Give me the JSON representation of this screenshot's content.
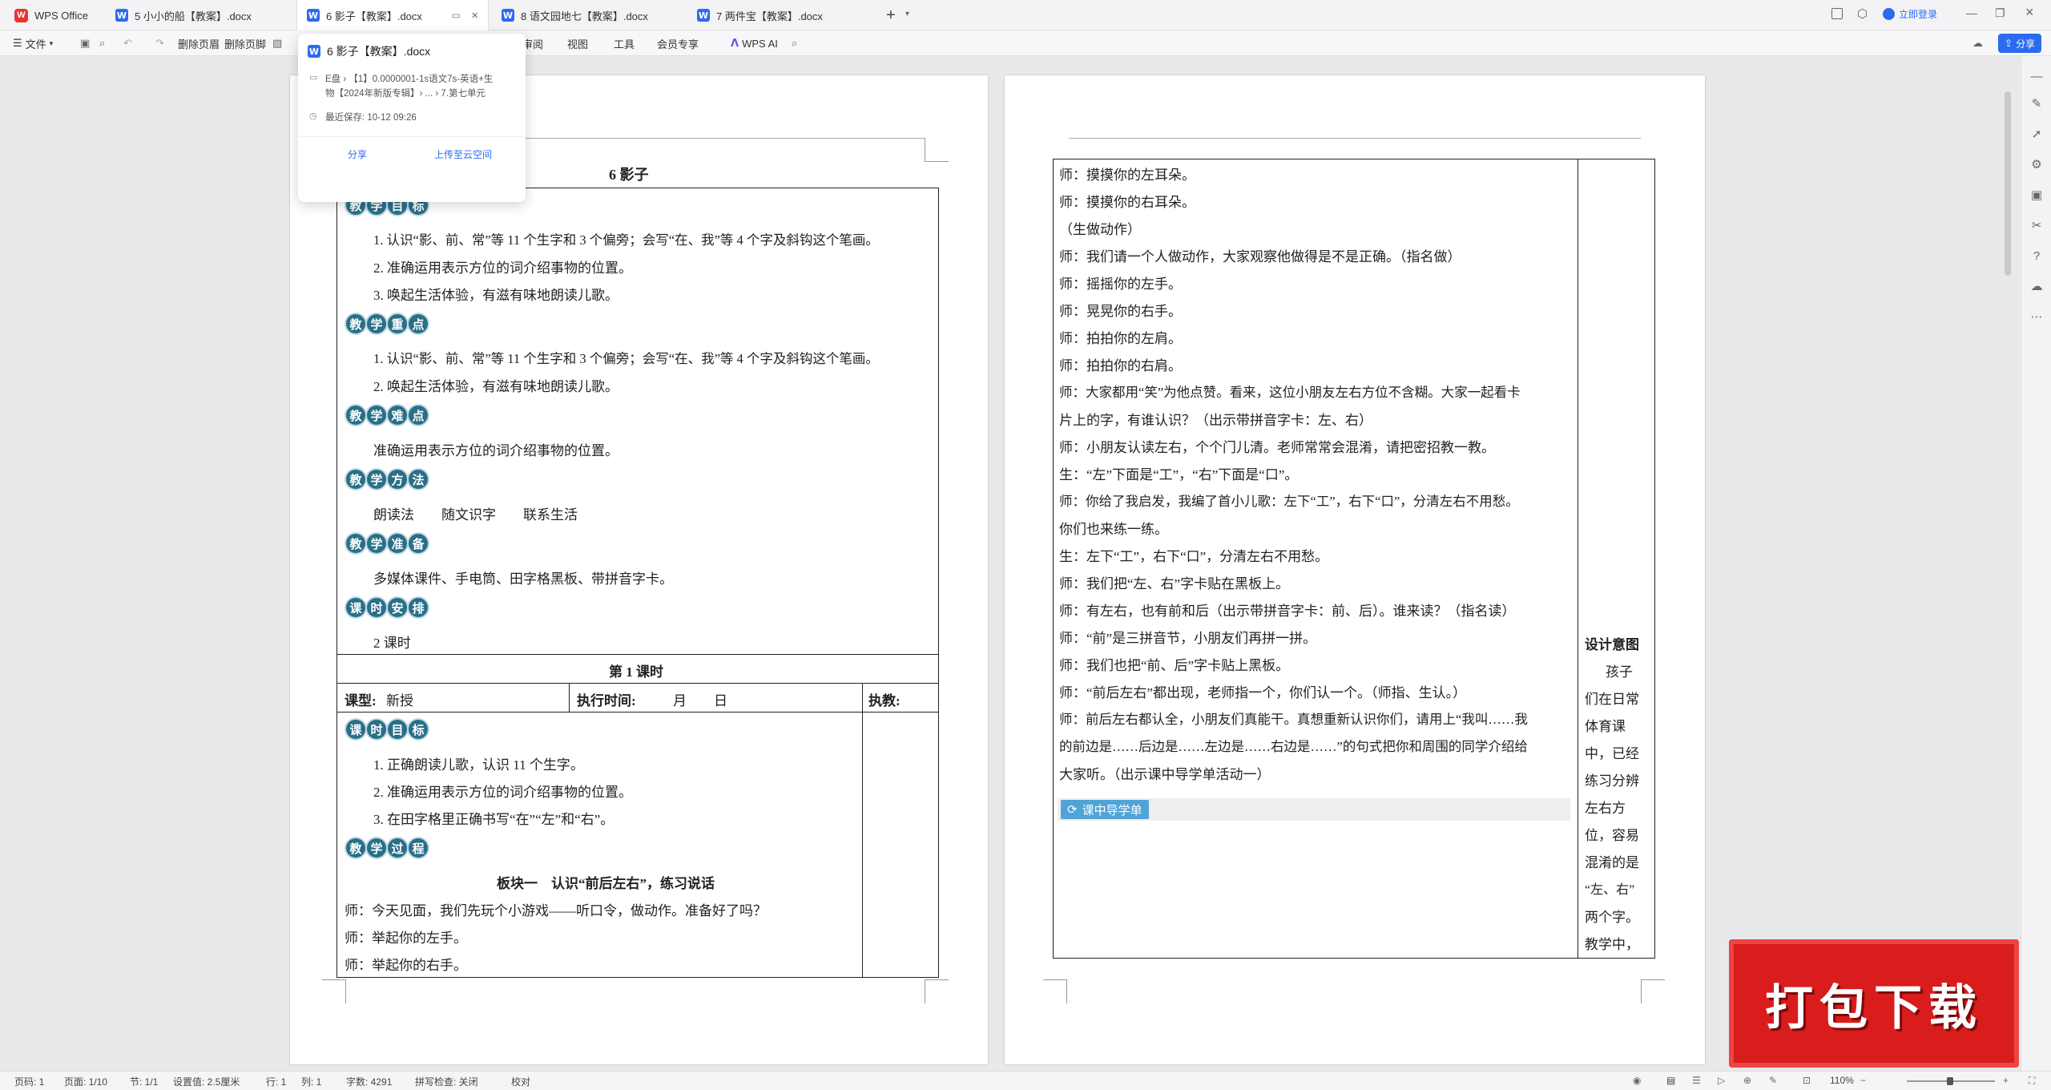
{
  "tabs": {
    "app": "WPS Office",
    "items": [
      {
        "label": "5 小小的船【教案】.docx"
      },
      {
        "label": "6 影子【教案】.docx"
      },
      {
        "label": "8 语文园地七【教案】.docx"
      },
      {
        "label": "7 两件宝【教案】.docx"
      }
    ],
    "login": "立即登录"
  },
  "menubar": {
    "file": "文件",
    "delete_header": "删除页眉",
    "delete_footer": "删除页脚",
    "review": "审阅",
    "view": "视图",
    "tools": "工具",
    "member": "会员专享",
    "wps_ai": "WPS AI",
    "share": "分享"
  },
  "popup": {
    "title": "6 影子【教案】.docx",
    "path_line1": "E盘 › 【1】0.0000001-1s语文7s-英语+生",
    "path_line2": "物【2024年新版专辑】› ... › 7.第七单元",
    "saved": "最近保存: 10-12 09:26",
    "share": "分享",
    "upload": "上传至云空间"
  },
  "left_page": {
    "title": "6 影子",
    "sections": {
      "goals": [
        "教",
        "学",
        "目",
        "标"
      ],
      "key": [
        "教",
        "学",
        "重",
        "点"
      ],
      "difficult": [
        "教",
        "学",
        "难",
        "点"
      ],
      "method": [
        "教",
        "学",
        "方",
        "法"
      ],
      "prep": [
        "教",
        "学",
        "准",
        "备"
      ],
      "schedule": [
        "课",
        "时",
        "安",
        "排"
      ],
      "lesson_goals": [
        "课",
        "时",
        "目",
        "标"
      ],
      "process": [
        "教",
        "学",
        "过",
        "程"
      ]
    },
    "goals_lines": [
      "1. 认识“影、前、常”等 11 个生字和 3 个偏旁；会写“在、我”等 4 个字及斜钩这个笔画。",
      "2. 准确运用表示方位的词介绍事物的位置。",
      "3. 唤起生活体验，有滋有味地朗读儿歌。"
    ],
    "key_lines": [
      "1. 认识“影、前、常”等 11 个生字和 3 个偏旁；会写“在、我”等 4 个字及斜钩这个笔画。",
      "2. 唤起生活体验，有滋有味地朗读儿歌。"
    ],
    "difficult_line": "准确运用表示方位的词介绍事物的位置。",
    "method_line": "朗读法　　随文识字　　联系生活",
    "prep_line": "多媒体课件、手电筒、田字格黑板、带拼音字卡。",
    "schedule_line": "2 课时",
    "lesson1": "第 1 课时",
    "type_label": "课型:",
    "type_value": "新授",
    "time_label": "执行时间:",
    "time_value": "月　　日",
    "teacher_label": "执教:",
    "lesson_goal_lines": [
      "1. 正确朗读儿歌，认识 11 个生字。",
      "2. 准确运用表示方位的词介绍事物的位置。",
      "3. 在田字格里正确书写“在”“左”和“右”。"
    ],
    "block_title": "板块一　认识“前后左右”，练习说话",
    "dialog": [
      "师：今天见面，我们先玩个小游戏——听口令，做动作。准备好了吗？",
      "师：举起你的左手。",
      "师：举起你的右手。"
    ]
  },
  "right_page": {
    "lines": [
      "师：摸摸你的左耳朵。",
      "师：摸摸你的右耳朵。",
      "（生做动作）",
      "师：我们请一个人做动作，大家观察他做得是不是正确。（指名做）",
      "师：摇摇你的左手。",
      "师：晃晃你的右手。",
      "师：拍拍你的左肩。",
      "师：拍拍你的右肩。",
      "师：大家都用“笑”为他点赞。看来，这位小朋友左右方位不含糊。大家一起看卡",
      "片上的字，有谁认识？（出示带拼音字卡：左、右）",
      "师：小朋友认读左右，个个门儿清。老师常常会混淆，请把密招教一教。",
      "生：“左”下面是“工”，“右”下面是“口”。",
      "师：你给了我启发，我编了首小儿歌：左下“工”，右下“口”，分清左右不用愁。",
      "你们也来练一练。",
      "生：左下“工”，右下“口”，分清左右不用愁。",
      "师：我们把“左、右”字卡贴在黑板上。",
      "师：有左右，也有前和后（出示带拼音字卡：前、后）。谁来读？（指名读）",
      "师：“前”是三拼音节，小朋友们再拼一拼。",
      "师：我们也把“前、后”字卡贴上黑板。",
      "师：“前后左右”都出现，老师指一个，你们认一个。（师指、生认。）",
      "师：前后左右都认全，小朋友们真能干。真想重新认识你们，请用上“我叫……我",
      "的前边是……后边是……左边是……右边是……”的句式把你和周围的同学介绍给",
      "大家听。（出示课中导学单活动一）"
    ],
    "guide_tag": "课中导学单",
    "design_title": "设计意图",
    "design_lines": [
      "孩子",
      "们在日常",
      "体育课",
      "中，已经",
      "练习分辨",
      "左右方",
      "位，容易",
      "混淆的是",
      "“左、右”",
      "两个字。",
      "教学中，"
    ]
  },
  "statusbar": {
    "page": "页码: 1",
    "pages": "页面: 1/10",
    "section": "节: 1/1",
    "setting": "设置值: 2.5厘米",
    "row": "行: 1",
    "col": "列: 1",
    "words": "字数: 4291",
    "spell": "拼写检查: 关闭",
    "proof": "校对",
    "zoom": "110%"
  },
  "stamp_text": "打包下载"
}
